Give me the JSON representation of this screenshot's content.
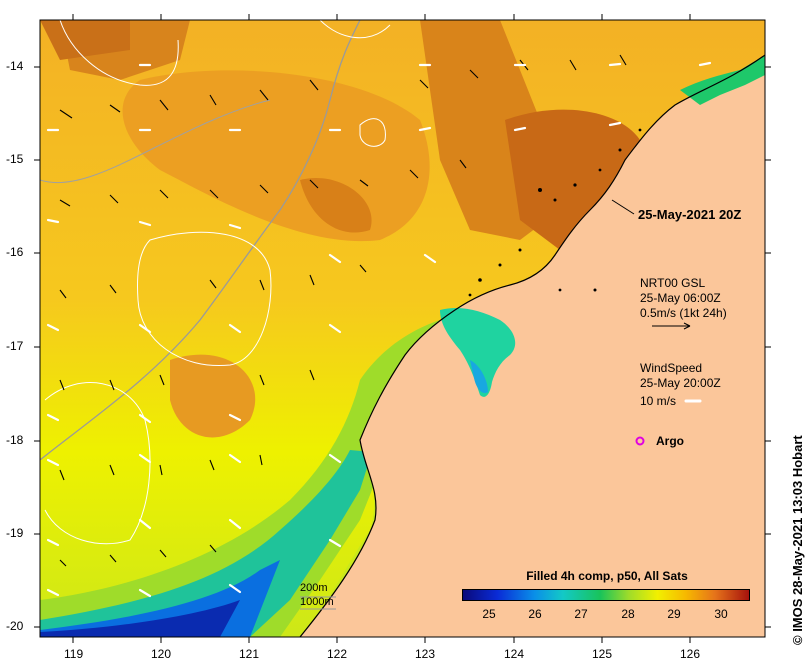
{
  "map": {
    "x_ticks": [
      "119",
      "120",
      "121",
      "122",
      "123",
      "124",
      "125",
      "126"
    ],
    "y_ticks": [
      "-14",
      "-15",
      "-16",
      "-17",
      "-18",
      "-19",
      "-20"
    ],
    "timestamp_label": "25-May-2021 20Z",
    "legend": {
      "current_title": "NRT00 GSL",
      "current_time": "25-May 06:00Z",
      "current_scale": "0.5m/s (1kt 24h)",
      "wind_title": "WindSpeed",
      "wind_time": "25-May 20:00Z",
      "wind_scale": "10 m/s",
      "argo_label": "Argo"
    },
    "depth_contours": [
      "200m",
      "1000m"
    ],
    "colorbar": {
      "title": "Filled 4h comp, p50, All Sats",
      "ticks": [
        "25",
        "26",
        "27",
        "28",
        "29",
        "30"
      ]
    },
    "credit": "© IMOS 28-May-2021 13:03 Hobart",
    "colors": {
      "land": "#fbc69a",
      "warm": "#f2a020",
      "hot": "#c96a14",
      "mid": "#f6e400",
      "cool": "#25c3d8",
      "cold": "#0a2fbf",
      "argo": "#e000e0"
    }
  }
}
